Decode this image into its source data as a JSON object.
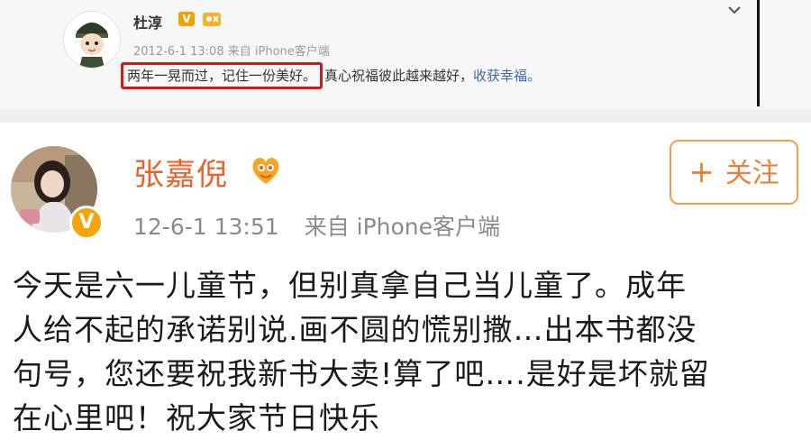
{
  "earlier_post": {
    "author": "杜淳",
    "timestamp": "2012-6-1 13:08",
    "source": "来自 iPhone客户端",
    "highlighted_text": "两年一晃而过，记住一份美好。",
    "rest_text": "真心祝福彼此越来越好，",
    "link_text": "收获幸福。",
    "highlight_color": "#d5161a",
    "vip_badge": "V"
  },
  "main_post": {
    "author": "张嘉倪",
    "timestamp": "12-6-1 13:51",
    "source": "来自 iPhone客户端",
    "follow_label": "关注",
    "follow_icon": "+",
    "vip_badge": "V",
    "name_color": "#e8622a",
    "accent_color": "#f0a04a",
    "body_lines": [
      "今天是六一儿童节，但别真拿自己当儿童了。成年",
      "人给不起的承诺别说.画不圆的慌别撒…出本书都没",
      "句号，您还要祝我新书大卖!算了吧….是好是坏就留",
      "在心里吧！祝大家节日快乐"
    ]
  }
}
